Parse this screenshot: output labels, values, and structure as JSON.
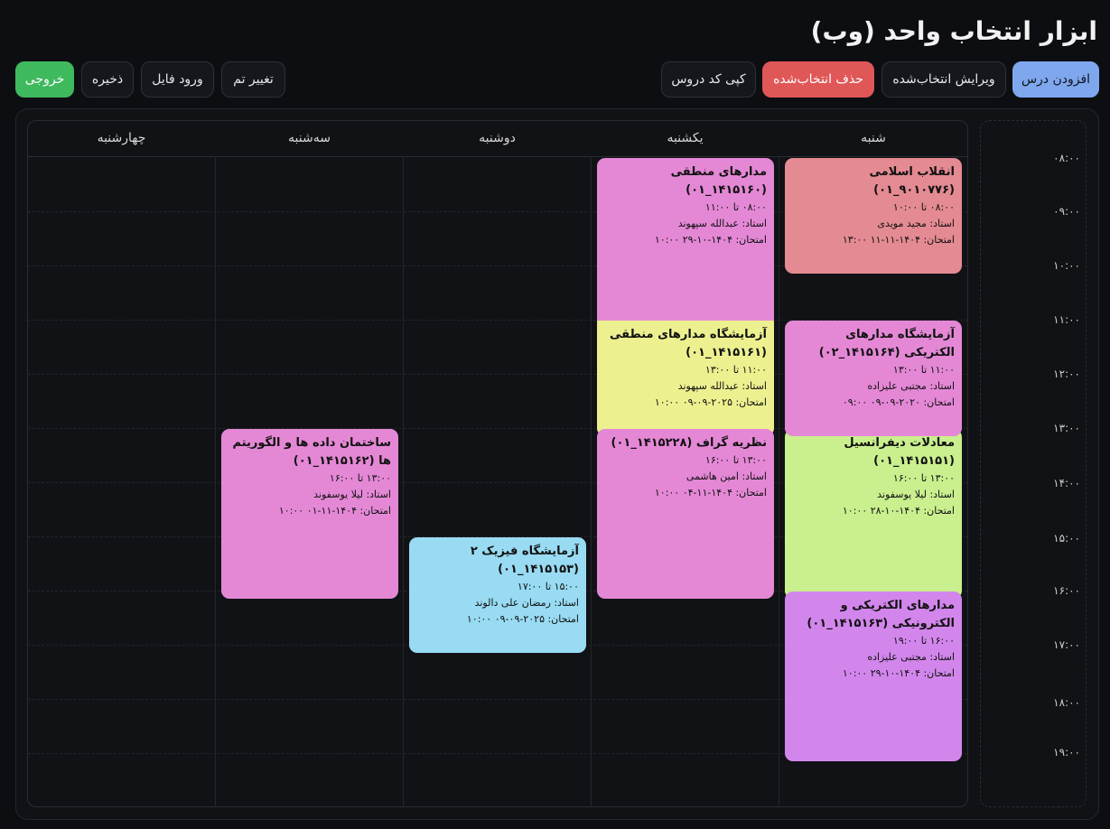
{
  "app": {
    "title": "ابزار انتخاب واحد (وب)"
  },
  "toolbar": {
    "add_course": "افزودن درس",
    "edit_selected": "ویرایش انتخاب‌شده",
    "delete_selected": "حذف انتخاب‌شده",
    "copy_codes": "کپی کد دروس",
    "change_theme": "تغییر تم",
    "import_file": "ورود فایل",
    "save": "ذخیره",
    "export": "خروجی"
  },
  "colors": {
    "add": "#7fa7ee",
    "delete": "#e05757",
    "export": "#3fb95d"
  },
  "days": [
    "شنبه",
    "یکشنبه",
    "دوشنبه",
    "سه‌شنبه",
    "چهارشنبه"
  ],
  "times": [
    "۰۸:۰۰",
    "۰۹:۰۰",
    "۱۰:۰۰",
    "۱۱:۰۰",
    "۱۲:۰۰",
    "۱۳:۰۰",
    "۱۴:۰۰",
    "۱۵:۰۰",
    "۱۶:۰۰",
    "۱۷:۰۰",
    "۱۸:۰۰",
    "۱۹:۰۰"
  ],
  "courses": [
    {
      "name": "انقلاب اسلامی (۹۰۱۰۷۷۶_۰۱)",
      "time": "۰۸:۰۰ تا ۱۰:۰۰",
      "teacher": "استاد: مجید مویدی",
      "exam": "امتحان: ۱۴۰۴-۱۱-۱۱ ۱۳:۰۰"
    },
    {
      "name": "مدارهای منطقی (۱۴۱۵۱۶۰_۰۱)",
      "time": "۰۸:۰۰ تا ۱۱:۰۰",
      "teacher": "استاد: عبدالله سپهوند",
      "exam": "امتحان: ۱۴۰۴-۱۰-۲۹ ۱۰:۰۰"
    },
    {
      "name": "آزمایشگاه مدارهای الکتریکی (۱۴۱۵۱۶۴_۰۲)",
      "time": "۱۱:۰۰ تا ۱۳:۰۰",
      "teacher": "استاد: مجتبی علیزاده",
      "exam": "امتحان: ۲۰۲۰-۰۹-۰۹ ۰۹:۰۰"
    },
    {
      "name": "آزمایشگاه مدارهای منطقی (۱۴۱۵۱۶۱_۰۱)",
      "time": "۱۱:۰۰ تا ۱۳:۰۰",
      "teacher": "استاد: عبدالله سپهوند",
      "exam": "امتحان: ۲۰۲۵-۰۹-۰۹ ۱۰:۰۰"
    },
    {
      "name": "معادلات دیفرانسیل (۱۴۱۵۱۵۱_۰۱)",
      "time": "۱۳:۰۰ تا ۱۶:۰۰",
      "teacher": "استاد: لیلا یوسفوند",
      "exam": "امتحان: ۱۴۰۴-۱۰-۲۸ ۱۰:۰۰"
    },
    {
      "name": "نظریه گراف (۱۴۱۵۲۲۸_۰۱)",
      "time": "۱۳:۰۰ تا ۱۶:۰۰",
      "teacher": "استاد: امین هاشمی",
      "exam": "امتحان: ۱۴۰۴-۱۱-۰۴ ۱۰:۰۰"
    },
    {
      "name": "ساختمان داده ها و الگوریتم ها (۱۴۱۵۱۶۲_۰۱)",
      "time": "۱۳:۰۰ تا ۱۶:۰۰",
      "teacher": "استاد: لیلا یوسفوند",
      "exam": "امتحان: ۱۴۰۴-۱۱-۰۱ ۱۰:۰۰"
    },
    {
      "name": "آزمایشگاه فیزیک ۲ (۱۴۱۵۱۵۳_۰۱)",
      "time": "۱۵:۰۰ تا ۱۷:۰۰",
      "teacher": "استاد: رمضان علی دالوند",
      "exam": "امتحان: ۲۰۲۵-۰۹-۰۹ ۱۰:۰۰"
    },
    {
      "name": "مدارهای الکتریکی و الکترونیکی (۱۴۱۵۱۶۳_۰۱)",
      "time": "۱۶:۰۰ تا ۱۹:۰۰",
      "teacher": "استاد: مجتبی علیزاده",
      "exam": "امتحان: ۱۴۰۴-۱۰-۲۹ ۱۰:۰۰"
    }
  ]
}
